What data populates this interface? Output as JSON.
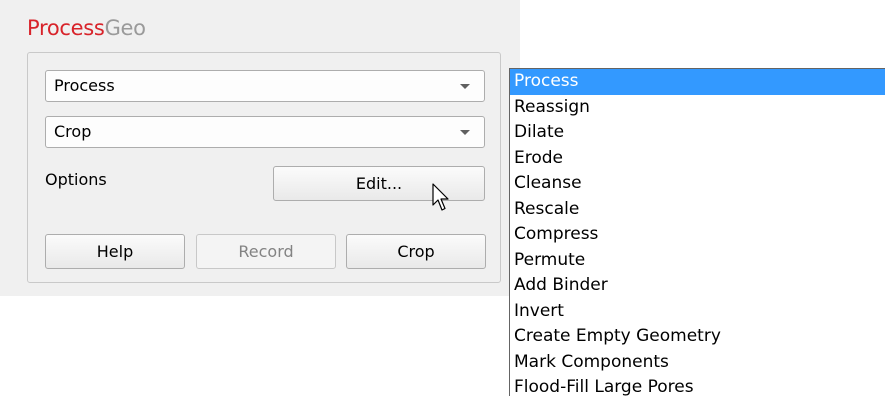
{
  "app": {
    "title_part1": "Process",
    "title_part2": "Geo"
  },
  "combos": {
    "category_value": "Process",
    "operation_value": "Crop"
  },
  "options": {
    "label": "Options",
    "edit_button": "Edit..."
  },
  "buttons": {
    "help": "Help",
    "record": "Record",
    "crop": "Crop"
  },
  "dropdown": {
    "selected_index": 0,
    "items": [
      "Process",
      "Reassign",
      "Dilate",
      "Erode",
      "Cleanse",
      "Rescale",
      "Compress",
      "Permute",
      "Add Binder",
      "Invert",
      "Create Empty Geometry",
      "Mark Components",
      "Flood-Fill Large Pores"
    ]
  },
  "colors": {
    "title_accent": "#d8232a",
    "title_secondary": "#9a9a9a",
    "selection": "#3399ff",
    "panel_background": "#f0f0f0"
  },
  "icons": {
    "combo_arrow": "chevron-down-icon",
    "pointer": "mouse-cursor-icon"
  }
}
